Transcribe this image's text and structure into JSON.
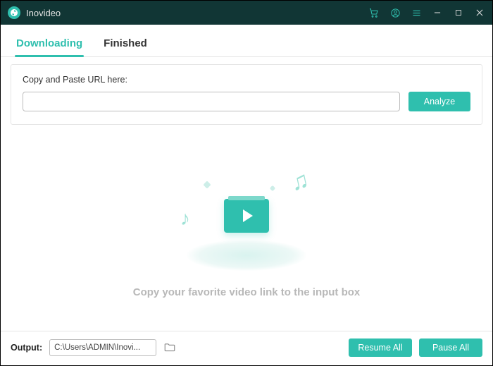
{
  "app": {
    "title": "Inovideo"
  },
  "tabs": {
    "downloading": "Downloading",
    "finished": "Finished",
    "active": "downloading"
  },
  "url_panel": {
    "label": "Copy and Paste URL here:",
    "value": "",
    "analyze_btn": "Analyze"
  },
  "empty_state": {
    "message": "Copy your favorite video link to the input box"
  },
  "footer": {
    "output_label": "Output:",
    "output_path": "C:\\Users\\ADMIN\\Inovi...",
    "resume_all": "Resume All",
    "pause_all": "Pause All"
  }
}
